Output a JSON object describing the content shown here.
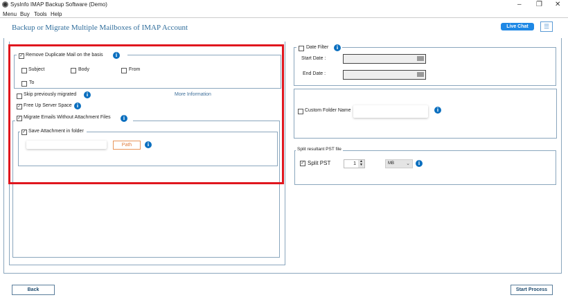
{
  "window": {
    "title": "SysInfo IMAP Backup Software (Demo)",
    "minimize": "–",
    "restore": "❐",
    "close": "✕"
  },
  "menu": [
    "Menu",
    "Buy",
    "Tools",
    "Help"
  ],
  "header": {
    "title": "Backup or Migrate Multiple Mailboxes of IMAP Account",
    "live_chat": "Live Chat",
    "hamburger": "☰"
  },
  "left": {
    "remove_duplicate": {
      "label": "Remove Duplicate Mail on the basis",
      "checked": true,
      "options": [
        {
          "label": "Subject",
          "checked": false
        },
        {
          "label": "Body",
          "checked": false
        },
        {
          "label": "From",
          "checked": false
        },
        {
          "label": "To",
          "checked": false
        }
      ]
    },
    "skip_migrated": {
      "label": "Skip previously migrated",
      "checked": false
    },
    "more_info": "More Information",
    "free_up": {
      "label": "Free Up Server Space",
      "checked": true
    },
    "migrate_without_attach": {
      "label": "Migrate Emails Without Attachment Files",
      "checked": true
    },
    "save_attachment": {
      "label": "Save Attachment in folder",
      "checked": true,
      "path_value": "",
      "path_button": "Path"
    }
  },
  "right": {
    "date_filter": {
      "label": "Date Filter",
      "checked": false,
      "start_label": "Start Date :",
      "end_label": "End Date :",
      "start_value": "",
      "end_value": ""
    },
    "custom_folder": {
      "label": "Custom Folder Name",
      "checked": false,
      "value": ""
    },
    "split": {
      "group_label": "Split resultant PST file",
      "label": "Split PST",
      "checked": true,
      "size": "1",
      "unit": "MB"
    }
  },
  "footer": {
    "back": "Back",
    "start": "Start Process"
  },
  "info_glyph": "i",
  "check_glyph": "✓",
  "colors": {
    "accent": "#1e88e5",
    "highlight": "#e0161e",
    "info": "#0b6fbf"
  }
}
